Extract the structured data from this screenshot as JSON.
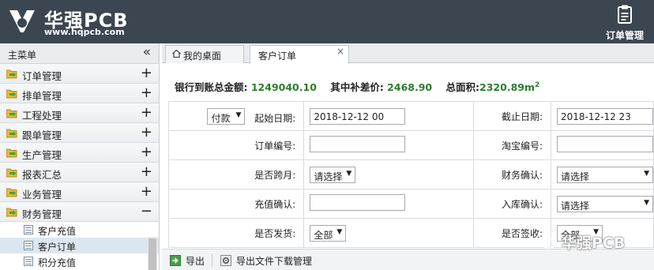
{
  "header": {
    "brand": "华强PCB",
    "url": "www.hqpcb.com",
    "right_button_label": "订单管理",
    "right_button_icon": "clipboard-icon"
  },
  "sidebar": {
    "title": "主菜单",
    "collapse_icon": "double-chevron-left-icon",
    "items": [
      {
        "label": "订单管理",
        "toggle": "+"
      },
      {
        "label": "排单管理",
        "toggle": "+"
      },
      {
        "label": "工程处理",
        "toggle": "+"
      },
      {
        "label": "跟单管理",
        "toggle": "+"
      },
      {
        "label": "生产管理",
        "toggle": "+"
      },
      {
        "label": "报表汇总",
        "toggle": "+"
      },
      {
        "label": "业务管理",
        "toggle": "+"
      },
      {
        "label": "财务管理",
        "toggle": "−"
      }
    ],
    "subitems": [
      {
        "label": "客户充值"
      },
      {
        "label": "客户订单"
      },
      {
        "label": "积分充值"
      }
    ]
  },
  "tabs": [
    {
      "label": "我的桌面",
      "icon": "home-icon"
    },
    {
      "label": "客户订单",
      "close": "×"
    }
  ],
  "summary": {
    "bank_label": "银行到账总金额:",
    "bank_value": "1249040.10",
    "subsidy_label": "其中补差价:",
    "subsidy_value": "2468.90",
    "area_label": "总面积:",
    "area_value": "2320.89m",
    "area_sup": "2"
  },
  "form": {
    "pay_type": "付款",
    "start_date_label": "起始日期:",
    "start_date_value": "2018-12-12 00",
    "end_date_label": "截止日期:",
    "end_date_value": "2018-12-12 23",
    "order_no_label": "订单编号:",
    "order_no_value": "",
    "taobao_no_label": "淘宝编号:",
    "taobao_no_value": "",
    "cross_month_label": "是否跨月:",
    "cross_month_value": "请选择",
    "finance_confirm_label": "财务确认:",
    "finance_confirm_value": "请选择",
    "recharge_confirm_label": "充值确认:",
    "recharge_confirm_value": "",
    "stock_confirm_label": "入库确认:",
    "stock_confirm_value": "请选择",
    "shipped_label": "是否发货:",
    "shipped_value": "全部",
    "signed_label": "是否签收:",
    "signed_value": "全部"
  },
  "toolbar": {
    "export_label": "导出",
    "export_download_label": "导出文件下载管理"
  },
  "watermark": {
    "text": "华强PCB"
  },
  "colors": {
    "header_bg": "#3c4651",
    "value_green": "#2b7d2b"
  }
}
